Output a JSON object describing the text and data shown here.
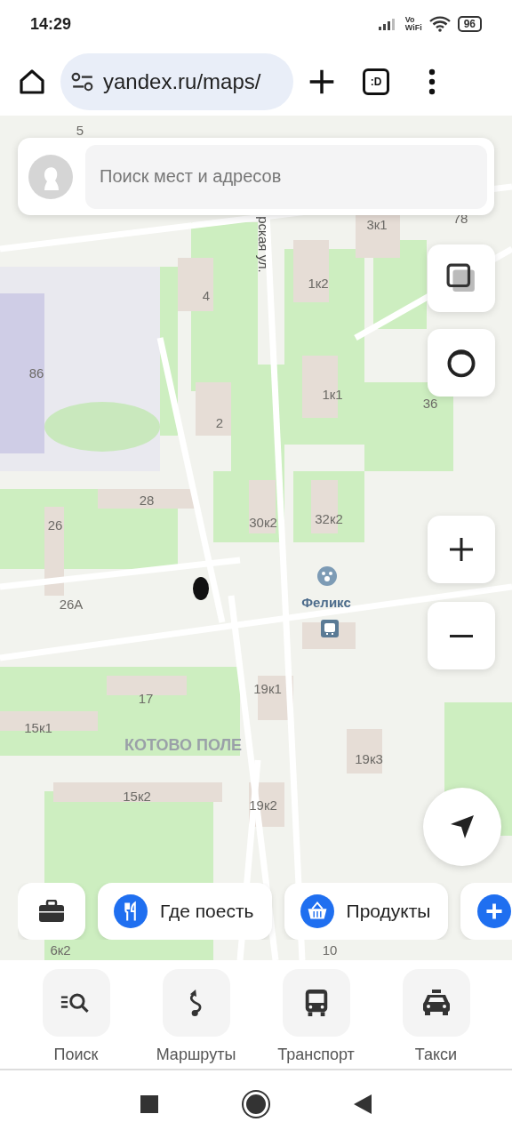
{
  "status_bar": {
    "time": "14:29",
    "volte_top": "Vo",
    "volte_bottom": "WiFi",
    "battery": "96"
  },
  "browser": {
    "url": "yandex.ru/maps/",
    "tab_switcher": ":D"
  },
  "search": {
    "placeholder": "Поиск мест и адресов"
  },
  "map_labels": [
    {
      "text": "5",
      "kind": "house"
    },
    {
      "text": "рская ул.",
      "kind": "street"
    },
    {
      "text": "3к1",
      "kind": "house"
    },
    {
      "text": "78",
      "kind": "house"
    },
    {
      "text": "1к2",
      "kind": "house"
    },
    {
      "text": "4",
      "kind": "house"
    },
    {
      "text": "86",
      "kind": "house"
    },
    {
      "text": "1к1",
      "kind": "house"
    },
    {
      "text": "36",
      "kind": "house"
    },
    {
      "text": "2",
      "kind": "house"
    },
    {
      "text": "28",
      "kind": "house"
    },
    {
      "text": "30к2",
      "kind": "house"
    },
    {
      "text": "32к2",
      "kind": "house"
    },
    {
      "text": "26",
      "kind": "house"
    },
    {
      "text": "26А",
      "kind": "house"
    },
    {
      "text": "Феликс",
      "kind": "poi"
    },
    {
      "text": "17",
      "kind": "house"
    },
    {
      "text": "15к1",
      "kind": "house"
    },
    {
      "text": "19к1",
      "kind": "house"
    },
    {
      "text": "КОТОВО ПОЛЕ",
      "kind": "district"
    },
    {
      "text": "19к3",
      "kind": "house"
    },
    {
      "text": "15к2",
      "kind": "house"
    },
    {
      "text": "19к2",
      "kind": "house"
    },
    {
      "text": "6к2",
      "kind": "house"
    },
    {
      "text": "10",
      "kind": "house"
    }
  ],
  "chips": [
    {
      "kind": "briefcase"
    },
    {
      "kind": "food",
      "label": "Где поесть"
    },
    {
      "kind": "groceries",
      "label": "Продукты"
    },
    {
      "kind": "more"
    }
  ],
  "bottom_tabs": [
    {
      "kind": "search",
      "label": "Поиск"
    },
    {
      "kind": "routes",
      "label": "Маршруты"
    },
    {
      "kind": "transport",
      "label": "Транспорт"
    },
    {
      "kind": "taxi",
      "label": "Такси"
    }
  ]
}
